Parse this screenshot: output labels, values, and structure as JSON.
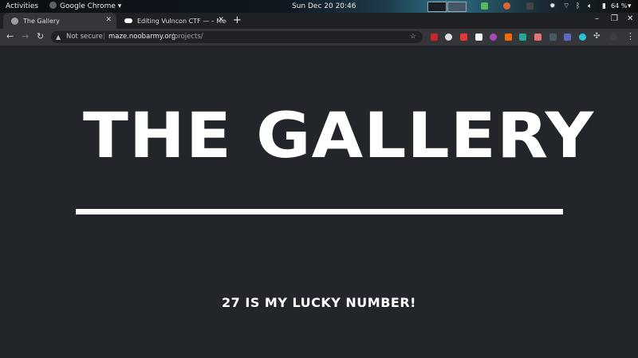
{
  "topbar": {
    "activities": "Activities",
    "app_name": "Google Chrome",
    "clock": "Sun Dec 20  20:46",
    "battery": "64 %"
  },
  "tabs": [
    {
      "title": "The Gallery",
      "active": true
    },
    {
      "title": "Editing Vulncon CTF — – Med",
      "active": false
    }
  ],
  "toolbar": {
    "security_label": "Not secure",
    "url_host": "maze.noobarmy.org",
    "url_path": "/projects/"
  },
  "page": {
    "heading": "THE GALLERY",
    "subtext": "27 IS MY LUCKY NUMBER!"
  },
  "colors": {
    "page_bg": "#222529",
    "text": "#ffffff",
    "tab_active": "#35363a"
  }
}
